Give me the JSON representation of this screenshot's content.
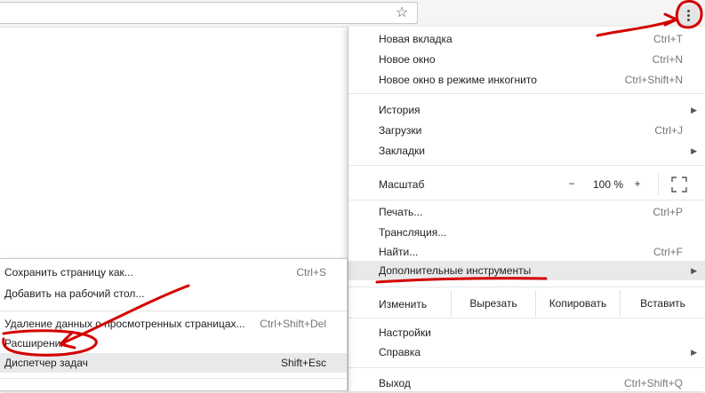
{
  "toolbar": {
    "star_icon": "bookmark-star-icon",
    "menu_icon": "kebab-menu-icon"
  },
  "menu": {
    "items_top": [
      {
        "label": "Новая вкладка",
        "shortcut": "Ctrl+T"
      },
      {
        "label": "Новое окно",
        "shortcut": "Ctrl+N"
      },
      {
        "label": "Новое окно в режиме инкогнито",
        "shortcut": "Ctrl+Shift+N"
      }
    ],
    "items_history": [
      {
        "label": "История",
        "shortcut": ""
      },
      {
        "label": "Загрузки",
        "shortcut": "Ctrl+J"
      },
      {
        "label": "Закладки",
        "shortcut": ""
      }
    ],
    "zoom": {
      "label": "Масштаб",
      "minus": "−",
      "value": "100 %",
      "plus": "+"
    },
    "items_page": [
      {
        "label": "Печать...",
        "shortcut": "Ctrl+P"
      },
      {
        "label": "Трансляция...",
        "shortcut": ""
      },
      {
        "label": "Найти...",
        "shortcut": "Ctrl+F"
      },
      {
        "label": "Дополнительные инструменты",
        "shortcut": ""
      }
    ],
    "edit": {
      "label": "Изменить",
      "cut": "Вырезать",
      "copy": "Копировать",
      "paste": "Вставить"
    },
    "items_settings": [
      {
        "label": "Настройки",
        "shortcut": ""
      },
      {
        "label": "Справка",
        "shortcut": ""
      }
    ],
    "exit": {
      "label": "Выход",
      "shortcut": "Ctrl+Shift+Q"
    }
  },
  "submenu": {
    "items": [
      {
        "label": "Сохранить страницу как...",
        "shortcut": "Ctrl+S"
      },
      {
        "label": "Добавить на рабочий стол...",
        "shortcut": ""
      },
      {
        "label": "Удаление данных о просмотренных страницах...",
        "shortcut": "Ctrl+Shift+Del"
      },
      {
        "label": "Расширения",
        "shortcut": ""
      },
      {
        "label": "Диспетчер задач",
        "shortcut": "Shift+Esc"
      }
    ]
  },
  "colors": {
    "annotation": "#d40000",
    "hover": "#e9e9e9"
  }
}
